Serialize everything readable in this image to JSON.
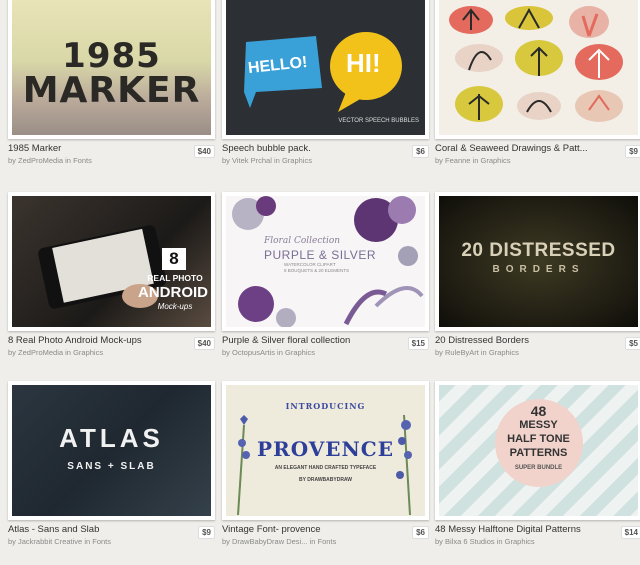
{
  "in_word": "in",
  "items": [
    {
      "title": "1985 Marker",
      "price": "$40",
      "author": "ZedProMedia",
      "category": "Fonts",
      "art": [
        "1985",
        "MARKER"
      ]
    },
    {
      "title": "Speech bubble pack.",
      "price": "$6",
      "author": "Vitek Prchal",
      "category": "Graphics",
      "art": [
        "HELLO!",
        "HI!",
        "VECTOR SPEECH BUBBLES"
      ]
    },
    {
      "title": "Coral & Seaweed Drawings & Patt...",
      "price": "$9",
      "author": "Feanne",
      "category": "Graphics",
      "art": []
    },
    {
      "title": "8 Real Photo Android Mock-ups",
      "price": "$40",
      "author": "ZedProMedia",
      "category": "Graphics",
      "art": [
        "8",
        "REAL PHOTO",
        "ANDROID",
        "Mock-ups"
      ]
    },
    {
      "title": "Purple & Silver floral collection",
      "price": "$15",
      "author": "OctopusArtis",
      "category": "Graphics",
      "art": [
        "Floral Collection",
        "PURPLE & SILVER",
        "WATERCOLOR CLIPART",
        "5 BOUQUETS & 20 ELEMENTS"
      ]
    },
    {
      "title": "20 Distressed Borders",
      "price": "$5",
      "author": "RuleByArt",
      "category": "Graphics",
      "art": [
        "20 DISTRESSED",
        "BORDERS"
      ]
    },
    {
      "title": "Atlas - Sans and Slab",
      "price": "$9",
      "author": "Jackrabbit Creative",
      "category": "Fonts",
      "art": [
        "ATLAS",
        "SANS + SLAB"
      ]
    },
    {
      "title": "Vintage Font- provence",
      "price": "$6",
      "author": "DrawBabyDraw Desi...",
      "category": "Fonts",
      "art": [
        "INTRODUCING",
        "PROVENCE",
        "AN ELEGANT HAND CRAFTED TYPEFACE",
        "BY DRAWBABYDRAW"
      ]
    },
    {
      "title": "48 Messy Halftone Digital Patterns",
      "price": "$14",
      "author": "Bilxa 6 Studios",
      "category": "Graphics",
      "art": [
        "48",
        "MESSY",
        "HALF TONE",
        "PATTERNS",
        "SUPER BUNDLE"
      ]
    }
  ]
}
